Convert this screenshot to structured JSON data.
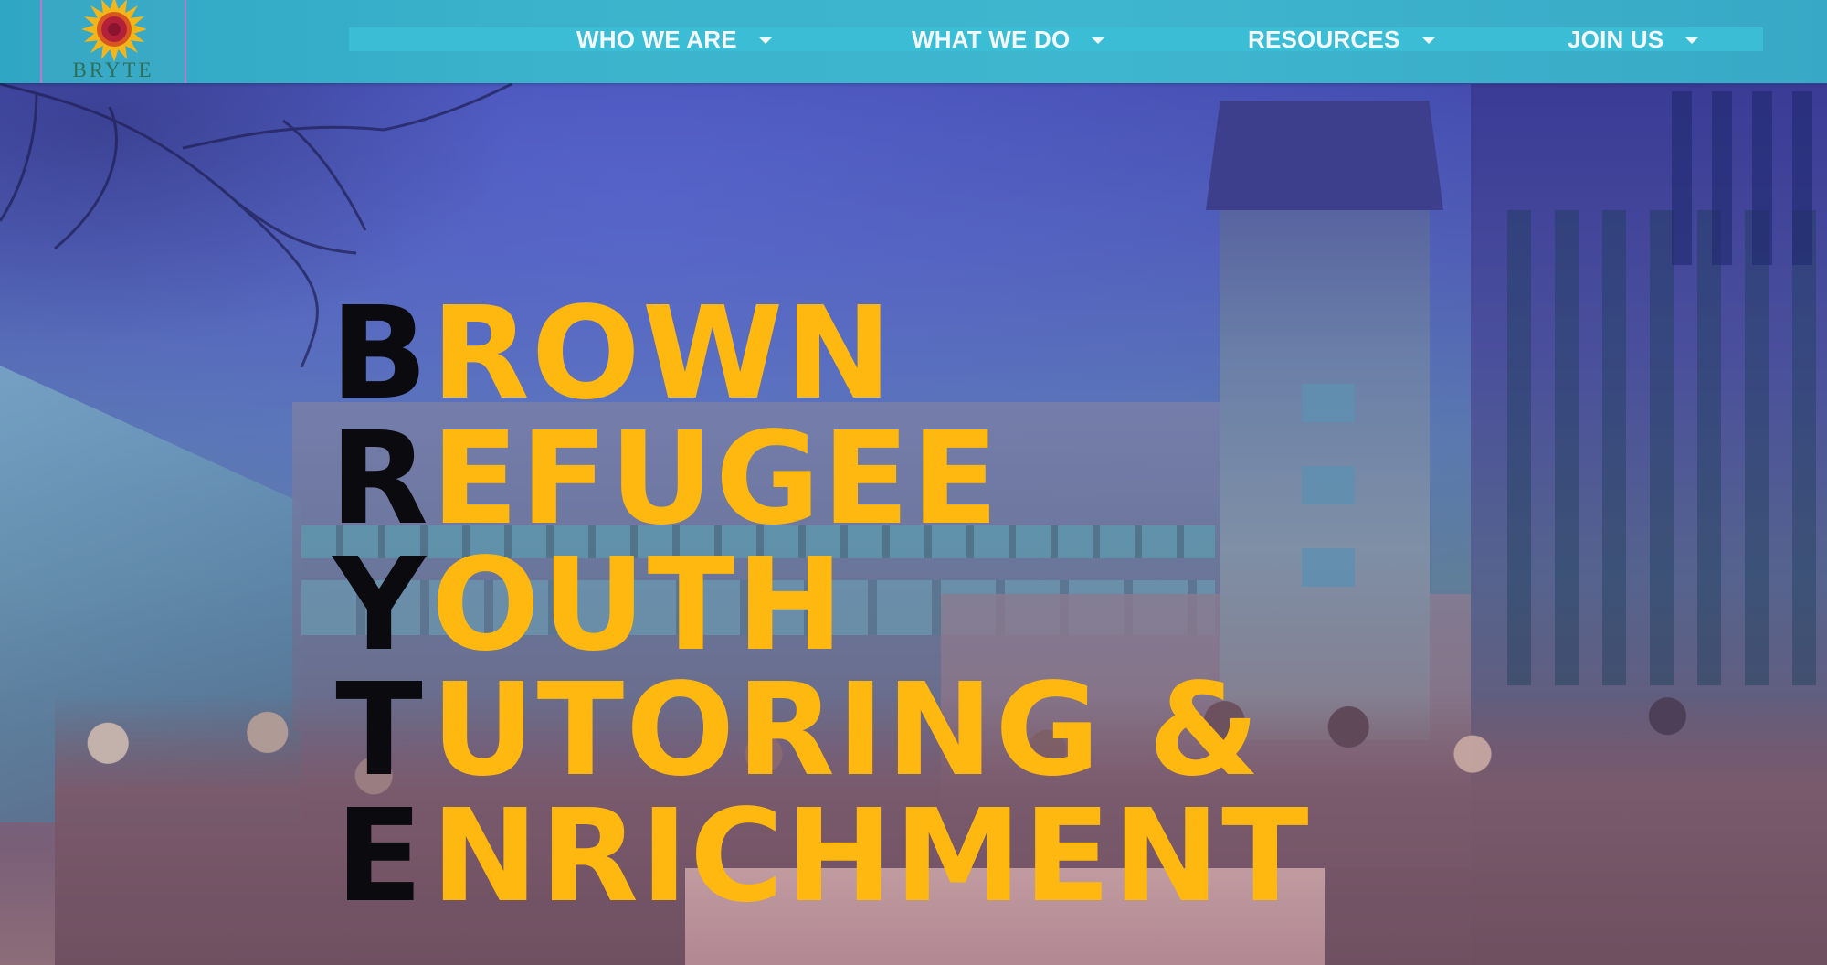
{
  "logo": {
    "text": "BRYTE",
    "colors": {
      "sun_outer": "#f2b51a",
      "sun_inner": "#b3203a",
      "border": "#c077c9"
    }
  },
  "nav": {
    "items": [
      {
        "label": "WHO WE ARE",
        "icon": "chevron-down-icon"
      },
      {
        "label": "WHAT WE DO",
        "icon": "chevron-down-icon"
      },
      {
        "label": "RESOURCES",
        "icon": "chevron-down-icon"
      },
      {
        "label": "JOIN US",
        "icon": "chevron-down-icon"
      }
    ],
    "colors": {
      "bar": "#3bb3cc",
      "text": "#f2f8fb"
    }
  },
  "hero": {
    "acronym": [
      {
        "letter": "B",
        "rest": "ROWN"
      },
      {
        "letter": "R",
        "rest": "EFUGEE"
      },
      {
        "letter": "Y",
        "rest": "OUTH"
      },
      {
        "letter": "T",
        "rest": "UTORING &"
      },
      {
        "letter": "E",
        "rest": "NRICHMENT"
      }
    ],
    "colors": {
      "initial": "#0b0b0f",
      "word": "#ffb80f",
      "overlay": "#3b40a8"
    }
  }
}
